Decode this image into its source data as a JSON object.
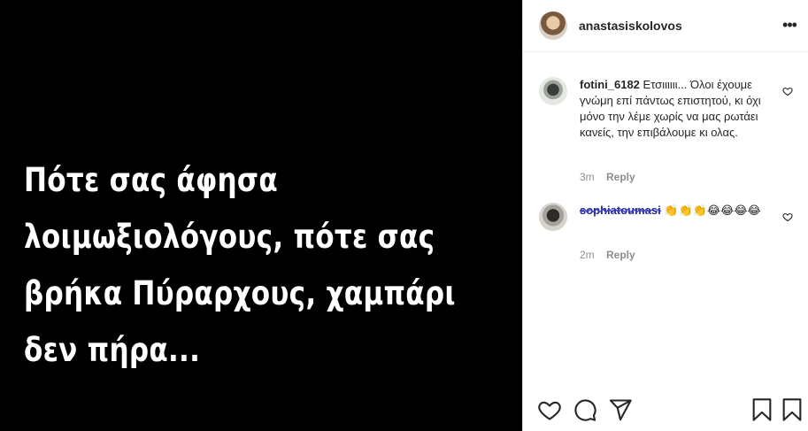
{
  "post": {
    "text_lines": [
      "Πότε σας άφησα",
      "λοιμωξιολόγους, πότε σας",
      "βρήκα Πύραρχους, χαμπάρι",
      "δεν πήρα..."
    ]
  },
  "header": {
    "owner_username": "anastasiskolovos",
    "more_icon": "•••"
  },
  "comments": [
    {
      "username": "fotini_6182",
      "text": "Ετσιιιιιι... Όλοι έχουμε γνώμη επί πάντως επιστητού, κι όχι μόνο την λέμε χωρίς να μας ρωτάει κανείς, την επιβάλουμε κι ολας.",
      "time": "3m",
      "reply_label": "Reply"
    },
    {
      "username": "sophiatoumasi",
      "text": "👏👏👏😂😂😂😂",
      "time": "2m",
      "reply_label": "Reply"
    }
  ],
  "icons": {
    "like": "heart-icon",
    "comment": "comment-icon",
    "share": "send-icon",
    "save": "bookmark-icon"
  }
}
